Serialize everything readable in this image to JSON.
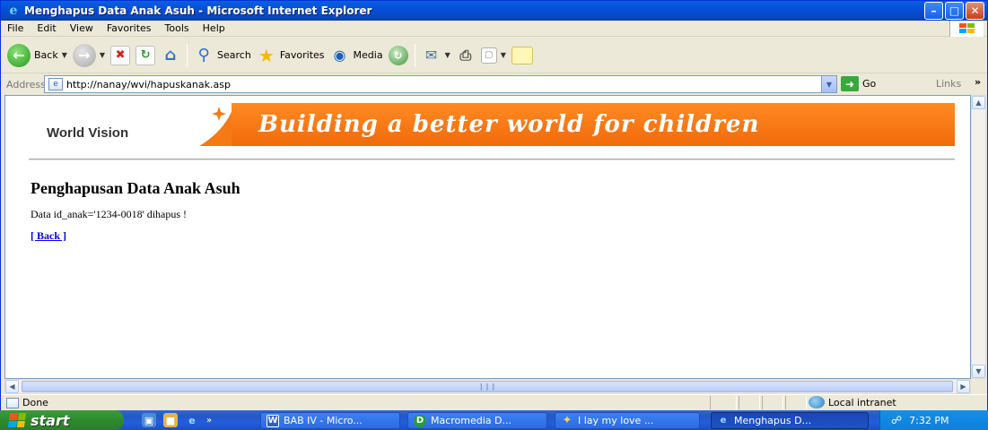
{
  "window": {
    "title": "Menghapus Data Anak Asuh - Microsoft Internet Explorer",
    "controls": {
      "minimize": "–",
      "maximize": "□",
      "close": "✕"
    }
  },
  "menu": [
    "File",
    "Edit",
    "View",
    "Favorites",
    "Tools",
    "Help"
  ],
  "toolbar": {
    "back_label": "Back",
    "search_label": "Search",
    "favorites_label": "Favorites",
    "media_label": "Media"
  },
  "address": {
    "label": "Address",
    "url": "http://nanay/wvi/hapuskanak.asp",
    "go_label": "Go",
    "links_label": "Links"
  },
  "page": {
    "logo_text": "World Vision",
    "slogan": "Building a better world for children",
    "heading": "Penghapusan Data Anak Asuh",
    "message": "Data id_anak='1234-0018' dihapus !",
    "back_link": "[ Back ]"
  },
  "status": {
    "text": "Done",
    "zone": "Local intranet"
  },
  "taskbar": {
    "start_label": "start",
    "tasks": [
      {
        "label": "BAB IV - Micro..."
      },
      {
        "label": "Macromedia D..."
      },
      {
        "label": "I lay my love ..."
      },
      {
        "label": "Menghapus D..."
      }
    ],
    "clock": "7:32 PM"
  },
  "colors": {
    "title_bar": "#0a54d6",
    "banner_orange": "#f57a15",
    "link": "#0000ee",
    "start_green": "#2e8a2e",
    "taskbar_blue": "#245edb"
  }
}
